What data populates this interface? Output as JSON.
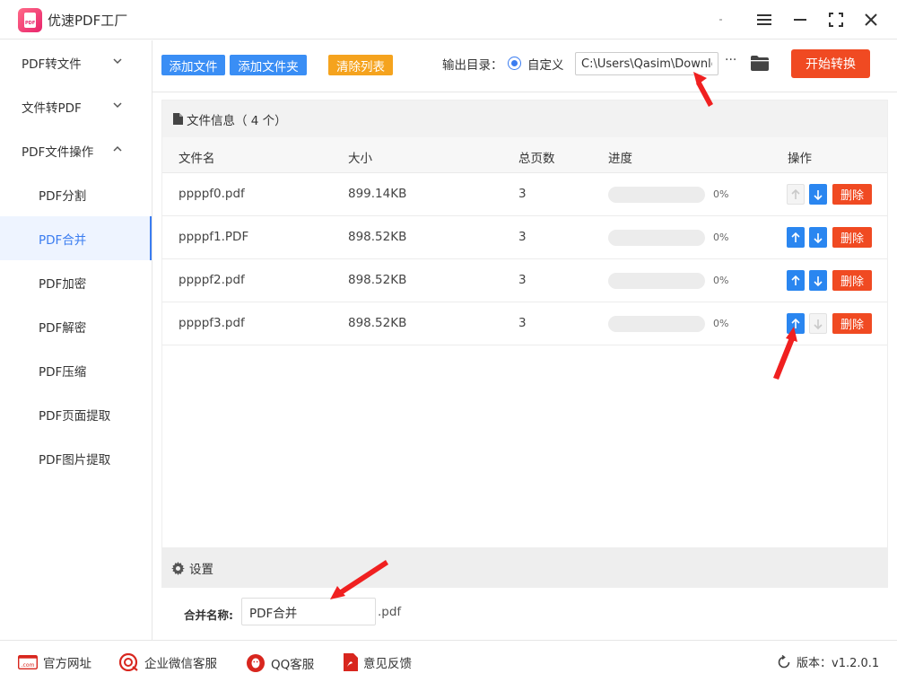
{
  "window": {
    "app_title": "优速PDF工厂",
    "logo_text": "PDF"
  },
  "sidebar": {
    "groups": [
      {
        "label": "PDF转文件"
      },
      {
        "label": "文件转PDF"
      },
      {
        "label": "PDF文件操作"
      }
    ],
    "items": [
      {
        "label": "PDF分割"
      },
      {
        "label": "PDF合并"
      },
      {
        "label": "PDF加密"
      },
      {
        "label": "PDF解密"
      },
      {
        "label": "PDF压缩"
      },
      {
        "label": "PDF页面提取"
      },
      {
        "label": "PDF图片提取"
      }
    ],
    "active_item": "PDF合并"
  },
  "toolbar": {
    "add_file": "添加文件",
    "add_folder": "添加文件夹",
    "clear_list": "清除列表",
    "output_label": "输出目录：",
    "radio_label": "自定义",
    "output_path": "C:\\Users\\Qasim\\Downloads",
    "more": "···",
    "start": "开始转换"
  },
  "file_panel": {
    "title": "文件信息（ 4 个）",
    "headers": {
      "name": "文件名",
      "size": "大小",
      "pages": "总页数",
      "progress": "进度",
      "actions": "操作"
    },
    "delete_label": "删除",
    "rows": [
      {
        "name": "ppppf0.pdf",
        "size": "899.14KB",
        "pages": "3",
        "progress_pct": "0%",
        "progress": 0,
        "up_enabled": false,
        "down_enabled": true
      },
      {
        "name": "ppppf1.PDF",
        "size": "898.52KB",
        "pages": "3",
        "progress_pct": "0%",
        "progress": 0,
        "up_enabled": true,
        "down_enabled": true
      },
      {
        "name": "ppppf2.pdf",
        "size": "898.52KB",
        "pages": "3",
        "progress_pct": "0%",
        "progress": 0,
        "up_enabled": true,
        "down_enabled": true
      },
      {
        "name": "ppppf3.pdf",
        "size": "898.52KB",
        "pages": "3",
        "progress_pct": "0%",
        "progress": 0,
        "up_enabled": true,
        "down_enabled": false
      }
    ]
  },
  "settings": {
    "title": "设置",
    "merge_label": "合并名称:",
    "merge_value": "PDF合并",
    "merge_suffix": ".pdf"
  },
  "footer": {
    "website": "官方网址",
    "wechat": "企业微信客服",
    "qq": "QQ客服",
    "feedback": "意见反馈",
    "version": "版本：v1.2.0.1",
    "com_badge": ".com"
  },
  "colors": {
    "primary_blue": "#3a8ef5",
    "orange": "#f5a31e",
    "red": "#f04a22",
    "active_blue": "#3a7cf0"
  }
}
